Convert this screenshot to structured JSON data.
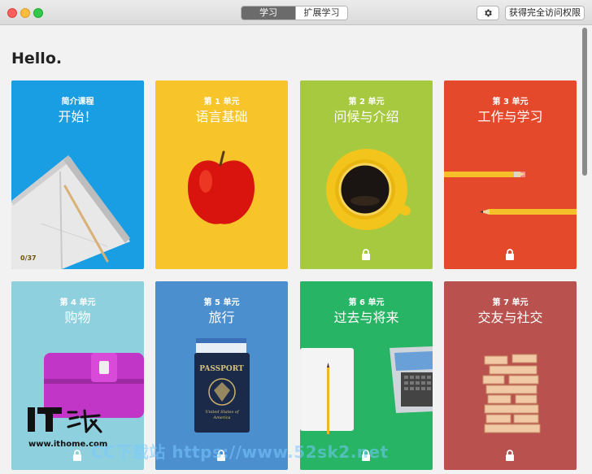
{
  "window": {
    "tabs": [
      {
        "label": "学习",
        "active": true
      },
      {
        "label": "扩展学习",
        "active": false
      }
    ],
    "settings_icon": "gear-icon",
    "access_label": "获得完全访问权限"
  },
  "main": {
    "greeting": "Hello."
  },
  "cards": [
    {
      "unit": "简介课程",
      "title": "开始！",
      "progress": "0/37",
      "locked": false,
      "color": "#1a9ee3"
    },
    {
      "unit": "第 1 单元",
      "title": "语言基础",
      "locked": false,
      "color": "#f7c52a"
    },
    {
      "unit": "第 2 单元",
      "title": "问候与介绍",
      "locked": true,
      "color": "#a6c93f"
    },
    {
      "unit": "第 3 单元",
      "title": "工作与学习",
      "locked": true,
      "color": "#e3492a"
    },
    {
      "unit": "第 4 单元",
      "title": "购物",
      "locked": true,
      "color": "#8fd0df"
    },
    {
      "unit": "第 5 单元",
      "title": "旅行",
      "locked": true,
      "color": "#4c8fcf"
    },
    {
      "unit": "第 6 单元",
      "title": "过去与将来",
      "locked": true,
      "color": "#27b464"
    },
    {
      "unit": "第 7 单元",
      "title": "交友与社交",
      "locked": true,
      "color": "#b9524e"
    }
  ],
  "passport_text": {
    "label": "PASSPORT",
    "country": "United States of America"
  },
  "watermarks": {
    "site": "www.ithome.com",
    "cc": "CC下载站 https://www.52sk2.net"
  }
}
